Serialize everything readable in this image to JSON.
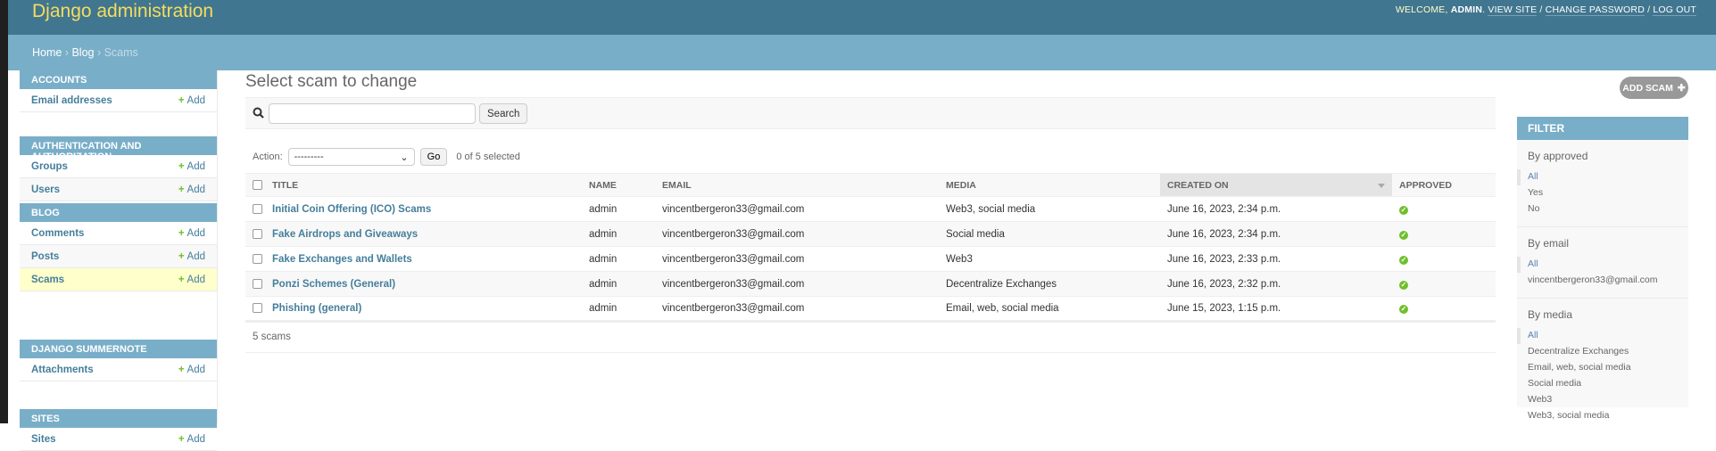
{
  "header": {
    "brand": "Django administration",
    "welcome": "Welcome,",
    "user": "admin",
    "view_site": "View site",
    "change_password": "Change password",
    "log_out": "Log out"
  },
  "breadcrumbs": {
    "home": "Home",
    "app": "Blog",
    "current": "Scams",
    "sep": " › "
  },
  "sidebar": {
    "add_label": "Add",
    "modules": [
      {
        "name": "Accounts",
        "items": [
          "Email addresses"
        ]
      },
      {
        "name": "Authentication and Authorization",
        "items": [
          "Groups",
          "Users"
        ]
      },
      {
        "name": "Blog",
        "items": [
          "Comments",
          "Posts",
          "Scams"
        ]
      },
      {
        "name": "Django Summernote",
        "items": [
          "Attachments"
        ]
      },
      {
        "name": "Sites",
        "items": [
          "Sites"
        ]
      }
    ]
  },
  "main": {
    "title": "Select scam to change",
    "add_button": "Add scam",
    "search": {
      "value": "",
      "button": "Search"
    },
    "actions": {
      "label": "Action:",
      "selected": "---------",
      "go": "Go",
      "counter": "0 of 5 selected"
    },
    "columns": [
      "Title",
      "Name",
      "Email",
      "Media",
      "Created on",
      "Approved"
    ],
    "rows": [
      {
        "title": "Initial Coin Offering (ICO) Scams",
        "name": "admin",
        "email": "vincentbergeron33@gmail.com",
        "media": "Web3, social media",
        "created": "June 16, 2023, 2:34 p.m.",
        "approved": true
      },
      {
        "title": "Fake Airdrops and Giveaways",
        "name": "admin",
        "email": "vincentbergeron33@gmail.com",
        "media": "Social media",
        "created": "June 16, 2023, 2:34 p.m.",
        "approved": true
      },
      {
        "title": "Fake Exchanges and Wallets",
        "name": "admin",
        "email": "vincentbergeron33@gmail.com",
        "media": "Web3",
        "created": "June 16, 2023, 2:33 p.m.",
        "approved": true
      },
      {
        "title": "Ponzi Schemes (General)",
        "name": "admin",
        "email": "vincentbergeron33@gmail.com",
        "media": "Decentralize Exchanges",
        "created": "June 16, 2023, 2:32 p.m.",
        "approved": true
      },
      {
        "title": "Phishing (general)",
        "name": "admin",
        "email": "vincentbergeron33@gmail.com",
        "media": "Email, web, social media",
        "created": "June 15, 2023, 1:15 p.m.",
        "approved": true
      }
    ],
    "count": "5 scams"
  },
  "filter": {
    "title": "Filter",
    "groups": [
      {
        "title": "By approved",
        "options": [
          "All",
          "Yes",
          "No"
        ]
      },
      {
        "title": "By email",
        "options": [
          "All",
          "vincentbergeron33@gmail.com"
        ]
      },
      {
        "title": "By media",
        "options": [
          "All",
          "Decentralize Exchanges",
          "Email, web, social media",
          "Social media",
          "Web3",
          "Web3, social media"
        ]
      }
    ]
  },
  "colors": {
    "header": "#417690",
    "breadcrumbs": "#79aec8",
    "brand": "#f5dd5d",
    "link": "#447e9b",
    "add": "#70bf2b",
    "current": "#ffffcc"
  }
}
